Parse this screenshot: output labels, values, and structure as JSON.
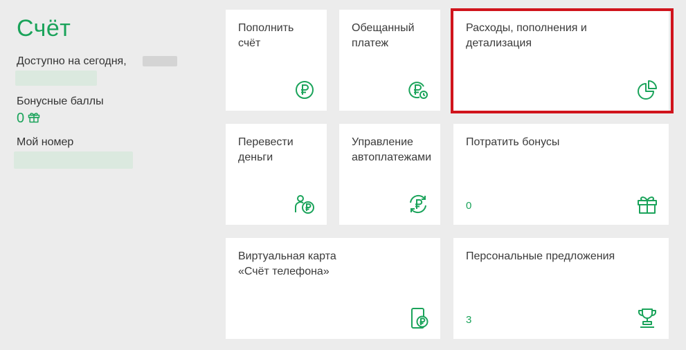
{
  "account": {
    "title": "Счёт",
    "available_label": "Доступно на сегодня,",
    "bonus_label": "Бонусные баллы",
    "bonus_value": "0",
    "number_label": "Мой номер"
  },
  "tiles": [
    {
      "label": "Пополнить\nсчёт",
      "icon": "ruble-coin-icon"
    },
    {
      "label": "Обещанный\nплатеж",
      "icon": "promised-payment-icon"
    },
    {
      "label": "Расходы, пополнения и\nдетализация",
      "icon": "pie-chart-icon"
    },
    {
      "label": "Перевести\nденьги",
      "icon": "money-transfer-icon"
    },
    {
      "label": "Управление\nавтоплатежами",
      "icon": "autopayment-icon"
    },
    {
      "label": "Потратить бонусы",
      "count": "0",
      "icon": "gift-icon"
    },
    {
      "label": "Виртуальная карта\n«Счёт телефона»",
      "icon": "phone-card-icon"
    },
    {
      "label": "Персональные предложения",
      "count": "3",
      "icon": "trophy-icon"
    }
  ],
  "colors": {
    "accent": "#1aa35a",
    "highlight": "#d0141c",
    "background": "#ececec"
  }
}
